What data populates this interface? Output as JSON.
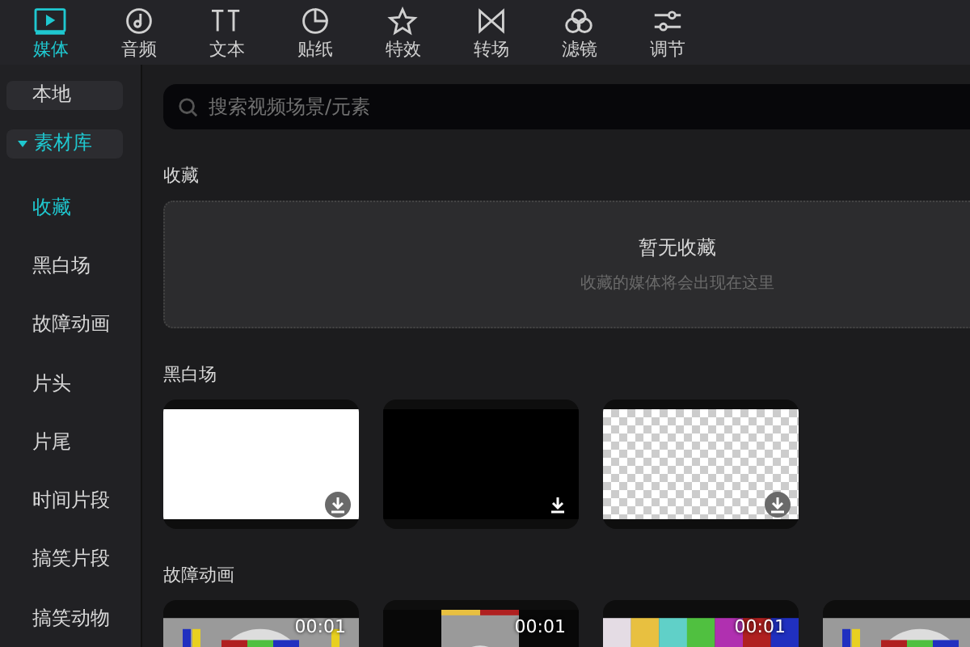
{
  "tabs": [
    {
      "label": "媒体",
      "selected": true
    },
    {
      "label": "音频",
      "selected": false
    },
    {
      "label": "文本",
      "selected": false
    },
    {
      "label": "贴纸",
      "selected": false
    },
    {
      "label": "特效",
      "selected": false
    },
    {
      "label": "转场",
      "selected": false
    },
    {
      "label": "滤镜",
      "selected": false
    },
    {
      "label": "调节",
      "selected": false
    }
  ],
  "sidebar": {
    "local": {
      "label": "本地"
    },
    "library": {
      "label": "素材库",
      "expanded": true,
      "children": [
        {
          "label": "收藏",
          "selected": true
        },
        {
          "label": "黑白场",
          "selected": false
        },
        {
          "label": "故障动画",
          "selected": false
        },
        {
          "label": "片头",
          "selected": false
        },
        {
          "label": "片尾",
          "selected": false
        },
        {
          "label": "时间片段",
          "selected": false
        },
        {
          "label": "搞笑片段",
          "selected": false
        },
        {
          "label": "搞笑动物",
          "selected": false
        }
      ]
    }
  },
  "search": {
    "placeholder": "搜索视频场景/元素"
  },
  "sections": [
    {
      "title": "收藏",
      "kind": "empty",
      "message": "暂无收藏",
      "hint": "收藏的媒体将会出现在这里"
    },
    {
      "title": "黑白场",
      "kind": "tiles",
      "tiles": [
        {
          "kind": "white",
          "download": true
        },
        {
          "kind": "black",
          "download": true
        },
        {
          "kind": "transparent",
          "download": true
        }
      ]
    },
    {
      "title": "故障动画",
      "kind": "tiles",
      "tiles": [
        {
          "kind": "picture",
          "duration": "00:01"
        },
        {
          "kind": "picture",
          "duration": "00:01"
        },
        {
          "kind": "picture",
          "duration": "00:01"
        },
        {
          "kind": "picture"
        }
      ]
    }
  ]
}
